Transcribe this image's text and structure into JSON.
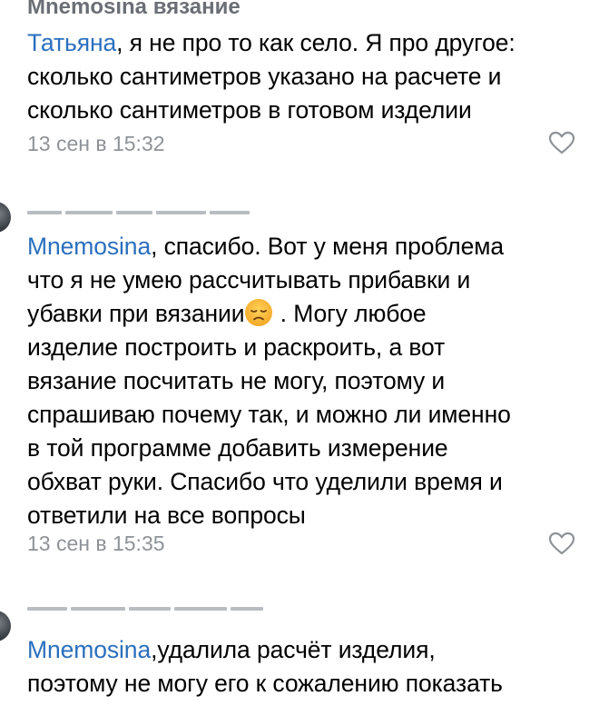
{
  "comments": [
    {
      "author": "Mnemosina вязание",
      "mention": "Татьяна",
      "lines_rest": [
        ", я не про то как село. Я про другое:"
      ],
      "lines": [
        "сколько сантиметров указано на расчете и",
        "сколько сантиметров в готовом изделии"
      ],
      "date": "13 сен в 15:32"
    },
    {
      "mention": "Mnemosina",
      "first_line_rest": ", спасибо. Вот у меня проблема",
      "line2": "что я не умею рассчитывать прибавки и",
      "line3_before_emoji": "убавки при вязании",
      "emoji": "disappointed-face",
      "line3_after_emoji": " . Могу любое",
      "lines": [
        "изделие построить и раскроить, а вот",
        "вязание посчитать не могу, поэтому и",
        "спрашиваю почему так, и можно ли именно",
        "в той программе добавить измерение",
        "обхват руки. Спасибо что уделили время и",
        "ответили на все вопросы"
      ],
      "date": "13 сен в 15:35"
    },
    {
      "mention": "Mnemosina",
      "first_line_rest": ",удалила расчёт изделия,",
      "line2": "поэтому не могу его к сожалению показать"
    }
  ],
  "colors": {
    "mention": "#2a6fbe",
    "meta": "#8e9297"
  },
  "icons": {
    "like": "heart-outline-icon"
  }
}
